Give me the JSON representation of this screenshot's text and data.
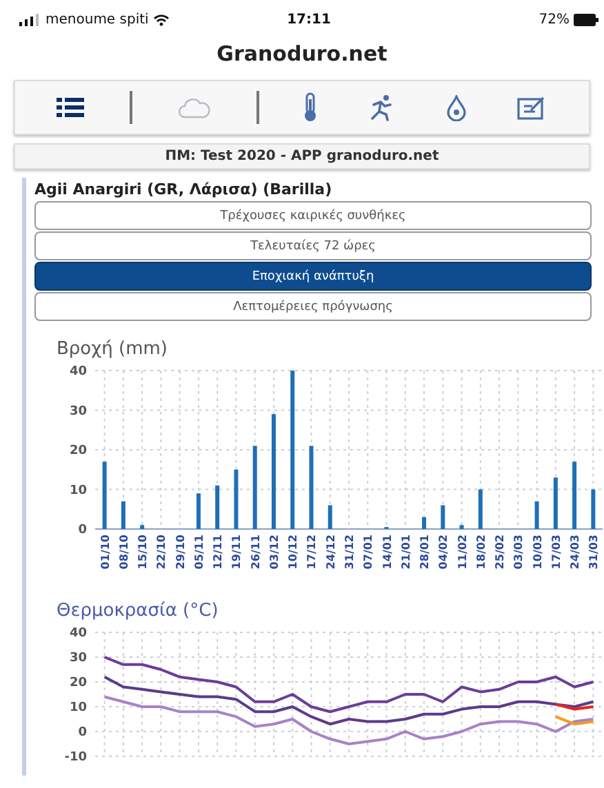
{
  "status_bar": {
    "carrier": "menoume spiti",
    "time": "17:11",
    "battery": "72%"
  },
  "header": {
    "title": "Granoduro.net"
  },
  "toolbar": [
    {
      "kind": "list",
      "selected": true
    },
    {
      "kind": "cloud",
      "selected": false
    },
    {
      "kind": "thermometer",
      "selected": false
    },
    {
      "kind": "plant",
      "selected": false
    },
    {
      "kind": "drop",
      "selected": false
    },
    {
      "kind": "note",
      "selected": false
    }
  ],
  "banner": "ΠΜ: Test 2020 - APP granoduro.net",
  "location": "Agii Anargiri (GR, Λάρισα) (Barilla)",
  "menu": [
    {
      "label": "Τρέχουσες καιρικές συνθήκες",
      "selected": false
    },
    {
      "label": "Τελευταίες 72 ώρες",
      "selected": false
    },
    {
      "label": "Εποχιακή ανάπτυξη",
      "selected": true
    },
    {
      "label": "Λεπτομέρειες πρόγνωσης",
      "selected": false
    }
  ],
  "rain": {
    "chart_data": {
      "type": "bar",
      "title": "Βροχή (mm)",
      "categories": [
        "01/10",
        "08/10",
        "15/10",
        "22/10",
        "29/10",
        "05/11",
        "12/11",
        "19/11",
        "26/11",
        "03/12",
        "10/12",
        "17/12",
        "24/12",
        "31/12",
        "07/01",
        "14/01",
        "21/01",
        "28/01",
        "04/02",
        "11/02",
        "18/02",
        "25/02",
        "03/03",
        "10/03",
        "17/03",
        "24/03",
        "31/03"
      ],
      "series": [
        {
          "color": "#1f6fb8",
          "values": [
            17,
            7,
            1,
            0,
            0,
            9,
            11,
            15,
            21,
            29,
            40,
            21,
            6,
            0,
            0,
            0.5,
            0,
            3,
            6,
            1,
            10,
            0,
            0,
            7,
            13,
            17,
            10
          ]
        }
      ],
      "ylim": [
        0,
        40
      ],
      "yticks": [
        0,
        10,
        20,
        30,
        40
      ],
      "grid": true
    }
  },
  "temperature": {
    "chart_data": {
      "type": "line",
      "title": "Θερμοκρασία (°C)",
      "series": [
        {
          "color": "#6a3d9a",
          "values": [
            30,
            27,
            27,
            25,
            22,
            21,
            20,
            18,
            12,
            12,
            15,
            10,
            8,
            10,
            12,
            12,
            15,
            15,
            12,
            18,
            16,
            17,
            20,
            20,
            22,
            18,
            20
          ]
        },
        {
          "color": "#5b3b8c",
          "values": [
            22,
            18,
            17,
            16,
            15,
            14,
            14,
            13,
            8,
            8,
            10,
            6,
            3,
            5,
            4,
            4,
            5,
            7,
            7,
            9,
            10,
            10,
            12,
            12,
            11,
            10,
            12
          ]
        },
        {
          "color": "#a882c8",
          "values": [
            14,
            12,
            10,
            10,
            8,
            8,
            8,
            6,
            2,
            3,
            5,
            0,
            -3,
            -5,
            -4,
            -3,
            0,
            -3,
            -2,
            0,
            3,
            4,
            4,
            3,
            0,
            4,
            5
          ]
        },
        {
          "color": "#e8261c",
          "values": [
            null,
            null,
            null,
            null,
            null,
            null,
            null,
            null,
            null,
            null,
            null,
            null,
            null,
            null,
            null,
            null,
            null,
            null,
            null,
            null,
            null,
            null,
            null,
            null,
            11,
            9,
            10
          ]
        },
        {
          "color": "#f39c1f",
          "values": [
            null,
            null,
            null,
            null,
            null,
            null,
            null,
            null,
            null,
            null,
            null,
            null,
            null,
            null,
            null,
            null,
            null,
            null,
            null,
            null,
            null,
            null,
            null,
            null,
            6,
            3,
            4
          ]
        }
      ],
      "ylim": [
        -10,
        40
      ],
      "yticks": [
        -10,
        0,
        10,
        20,
        30,
        40
      ],
      "grid": true
    }
  }
}
